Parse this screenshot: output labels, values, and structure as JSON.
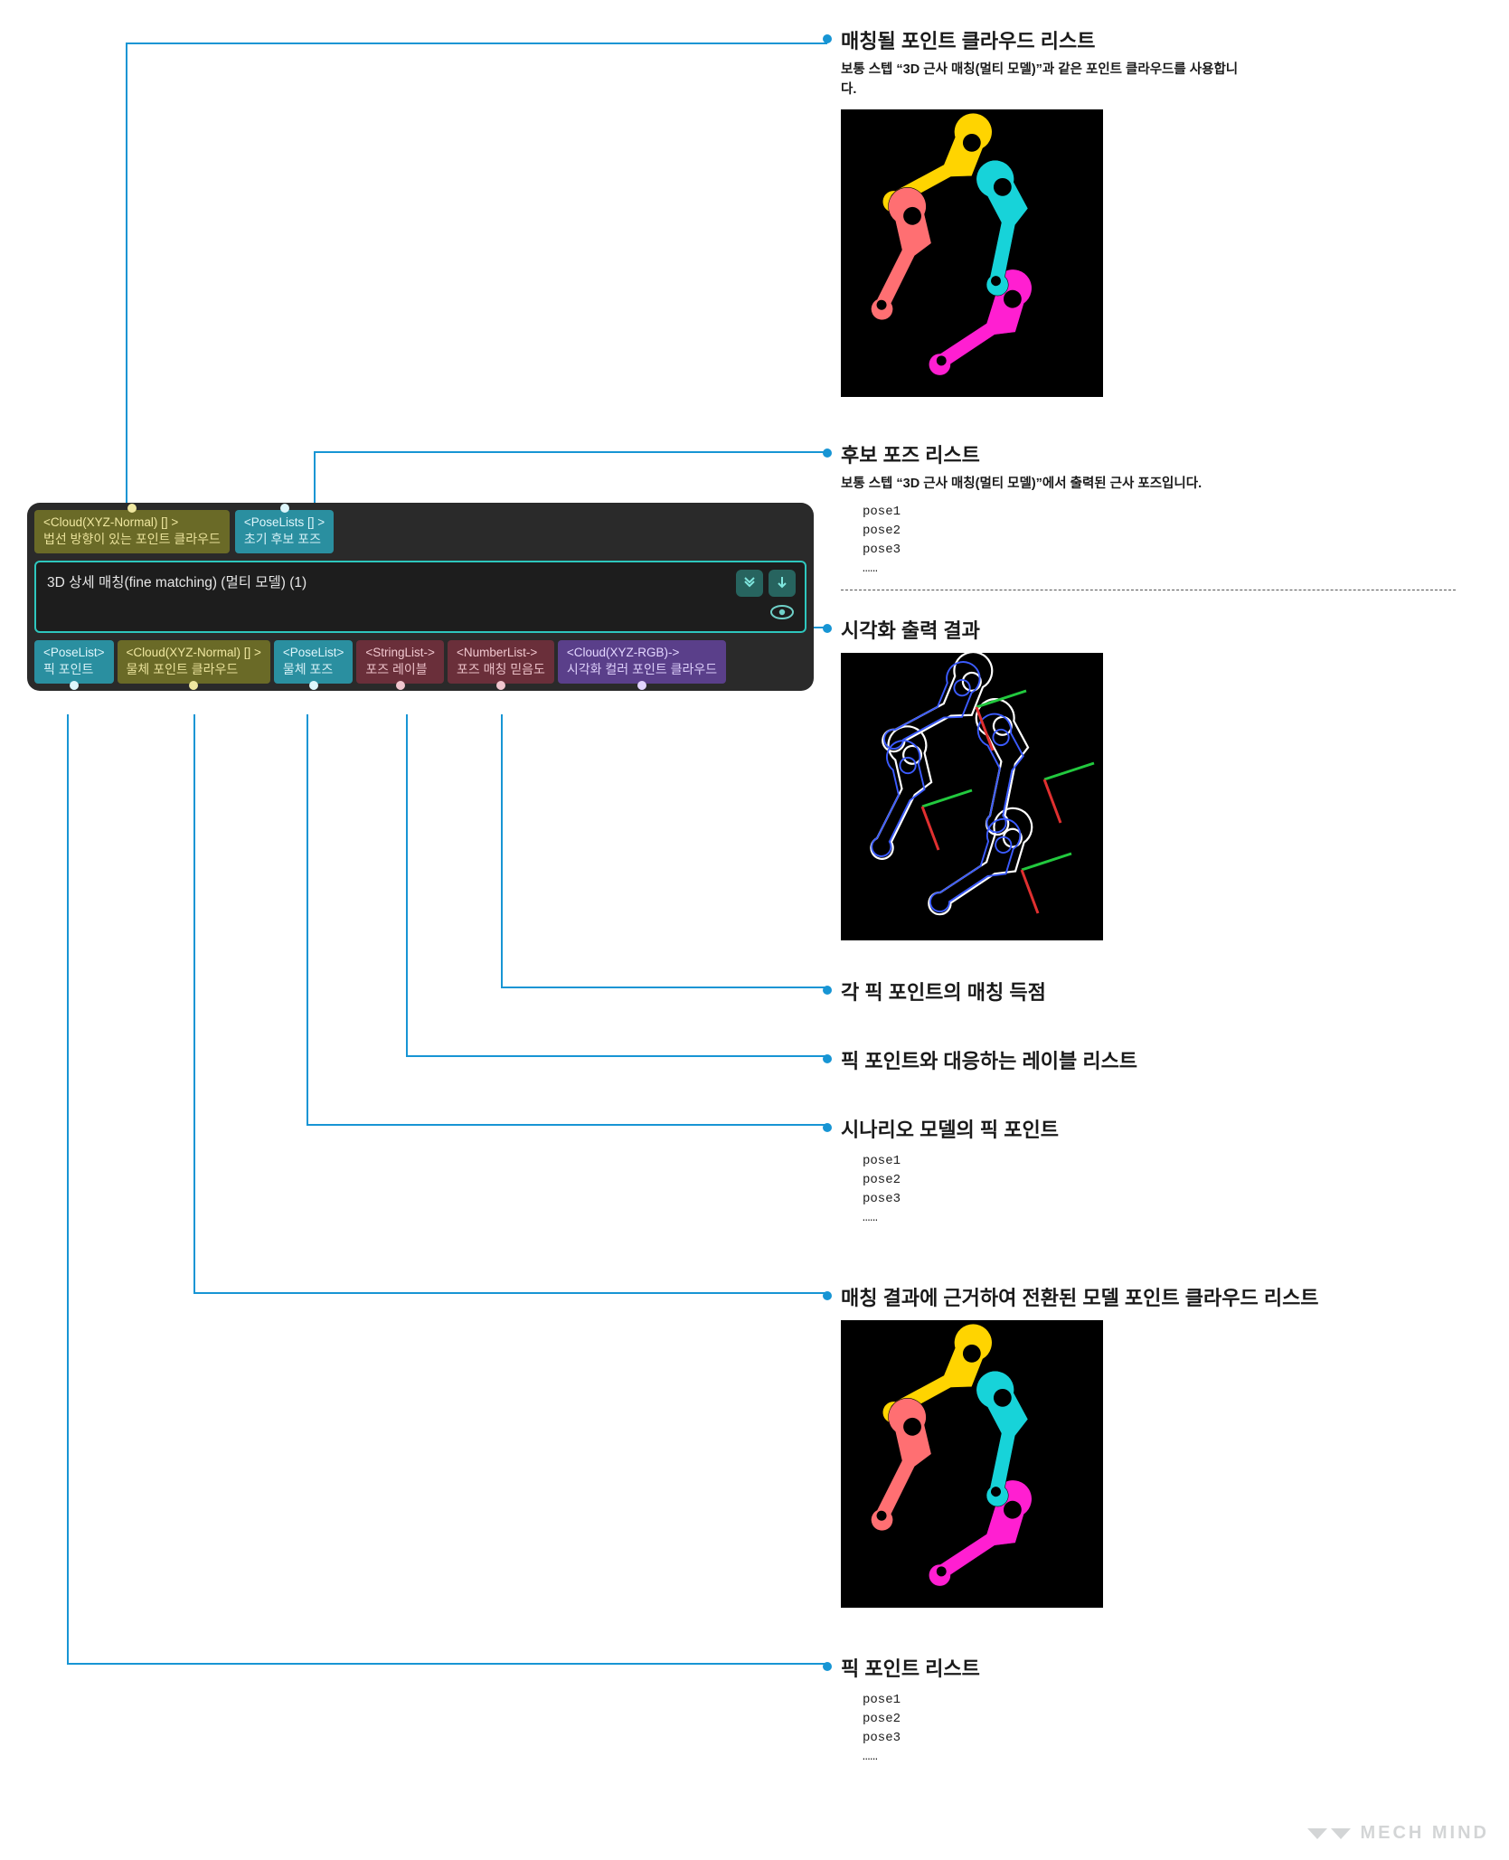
{
  "node": {
    "title": "3D 상세 매칭(fine matching)  (멀티 모델)   (1)",
    "inputs": [
      {
        "type": "<Cloud(XYZ-Normal) [] >",
        "label": "법선 방향이 있는 포인트 클라우드",
        "color": "olive"
      },
      {
        "type": "<PoseLists [] >",
        "label": "초기 후보 포즈",
        "color": "teal"
      }
    ],
    "outputs": [
      {
        "type": "<PoseList>",
        "label": "픽 포인트",
        "color": "teal"
      },
      {
        "type": "<Cloud(XYZ-Normal) [] >",
        "label": "물체 포인트 클라우드",
        "color": "olive"
      },
      {
        "type": "<PoseList>",
        "label": "물체 포즈",
        "color": "teal"
      },
      {
        "type": "<StringList->",
        "label": "포즈 레이블",
        "color": "maroon"
      },
      {
        "type": "<NumberList->",
        "label": "포즈 매칭 믿음도",
        "color": "maroon"
      },
      {
        "type": "<Cloud(XYZ-RGB)->",
        "label": "시각화 컬러 포인트 클라우드",
        "color": "purple"
      }
    ]
  },
  "annotations": {
    "in0": {
      "title": "매칭될 포인트 클라우드 리스트",
      "sub": "보통 스텝 “3D 근사 매칭(멀티 모델)”과 같은 포인트 클라우드를 사용합니다."
    },
    "in1": {
      "title": "후보 포즈 리스트",
      "sub": "보통 스텝 “3D 근사 매칭(멀티 모델)”에서 출력된 근사 포즈입니다."
    },
    "vis": {
      "title": "시각화 출력 결과"
    },
    "out4": {
      "title": "각 픽 포인트의 매칭 득점"
    },
    "out3": {
      "title": "픽 포인트와 대응하는 레이블 리스트"
    },
    "out2": {
      "title": "시나리오 모델의 픽 포인트"
    },
    "out1": {
      "title": "매칭 결과에 근거하여 전환된 모델 포인트 클라우드 리스트"
    },
    "out0": {
      "title": "픽 포인트 리스트"
    }
  },
  "pose_list": [
    "pose1",
    "pose2",
    "pose3",
    "……"
  ],
  "watermark": "MECH MIND"
}
